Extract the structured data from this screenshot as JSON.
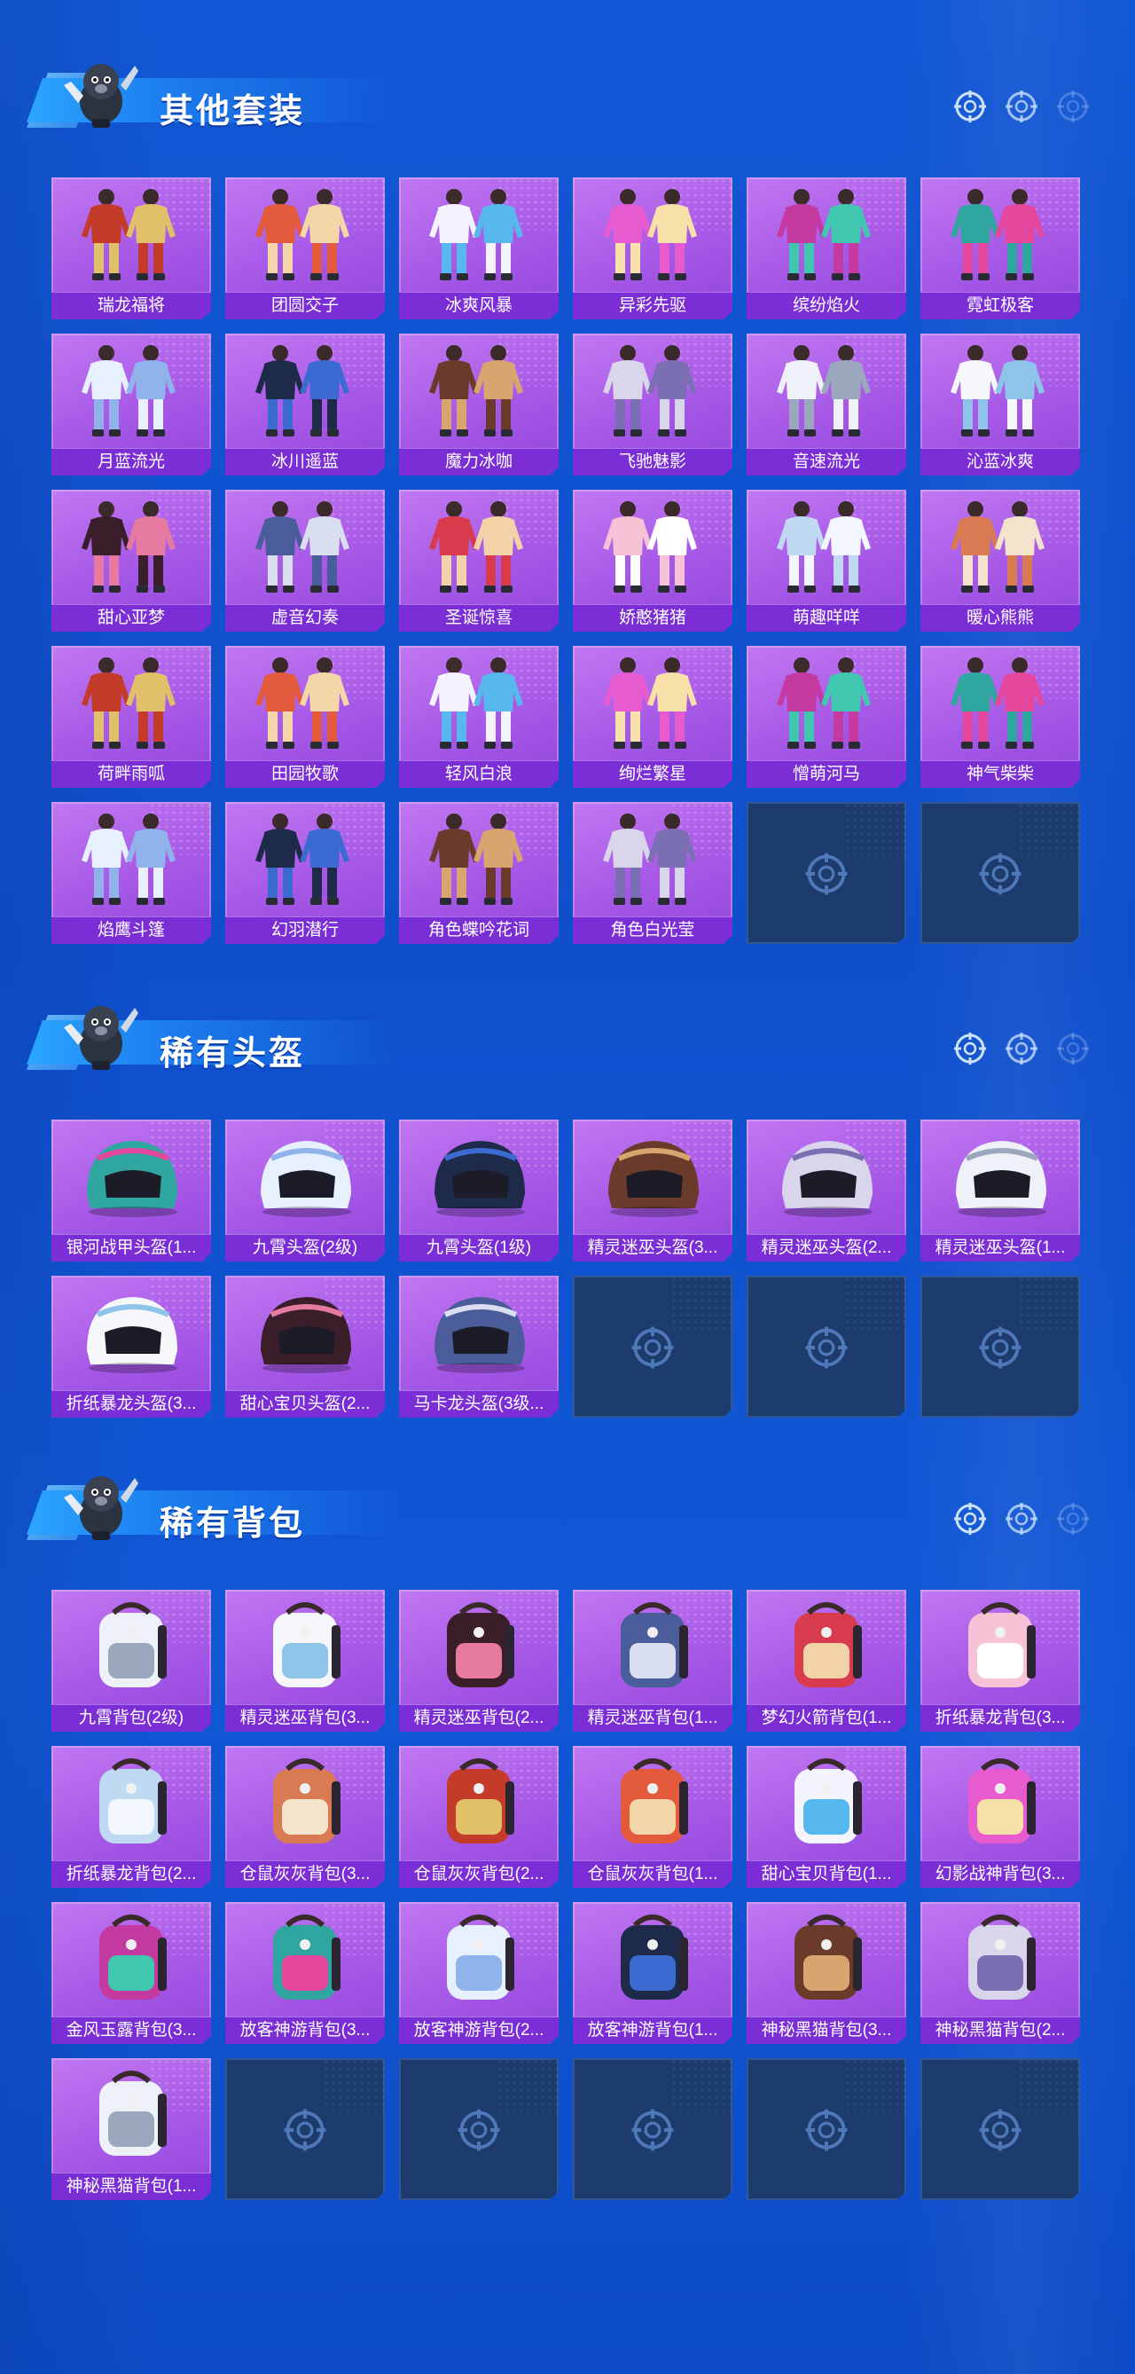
{
  "colors": {
    "background": "#1158d6",
    "card": "#a658e6",
    "label_bar": "#7b2ed6",
    "empty_card": "#1d3c6d",
    "title_text": "#ffffff"
  },
  "sections": [
    {
      "title": "其他套装",
      "items": [
        "瑞龙福将",
        "团圆交子",
        "冰爽风暴",
        "异彩先驱",
        "缤纷焰火",
        "霓虹极客",
        "月蓝流光",
        "冰川遥蓝",
        "魔力冰咖",
        "飞驰魅影",
        "音速流光",
        "沁蓝冰爽",
        "甜心亚梦",
        "虚音幻奏",
        "圣诞惊喜",
        "娇憨猪猪",
        "萌趣咩咩",
        "暖心熊熊",
        "荷畔雨呱",
        "田园牧歌",
        "轻风白浪",
        "绚烂繁星",
        "憎萌河马",
        "神气柴柴",
        "焰鹰斗篷",
        "幻羽潜行",
        "角色蝶吟花词",
        "角色白光莹"
      ],
      "empty_slots": 2
    },
    {
      "title": "稀有头盔",
      "items": [
        "银河战甲头盔(1...",
        "九霄头盔(2级)",
        "九霄头盔(1级)",
        "精灵迷巫头盔(3...",
        "精灵迷巫头盔(2...",
        "精灵迷巫头盔(1...",
        "折纸暴龙头盔(3...",
        "甜心宝贝头盔(2...",
        "马卡龙头盔(3级..."
      ],
      "empty_slots": 3
    },
    {
      "title": "稀有背包",
      "items": [
        "九霄背包(2级)",
        "精灵迷巫背包(3...",
        "精灵迷巫背包(2...",
        "精灵迷巫背包(1...",
        "梦幻火箭背包(1...",
        "折纸暴龙背包(3...",
        "折纸暴龙背包(2...",
        "仓鼠灰灰背包(3...",
        "仓鼠灰灰背包(2...",
        "仓鼠灰灰背包(1...",
        "甜心宝贝背包(1...",
        "幻影战神背包(3...",
        "金风玉露背包(3...",
        "放客神游背包(3...",
        "放客神游背包(2...",
        "放客神游背包(1...",
        "神秘黑猫背包(3...",
        "神秘黑猫背包(2...",
        "神秘黑猫背包(1..."
      ],
      "empty_slots": 5
    }
  ]
}
